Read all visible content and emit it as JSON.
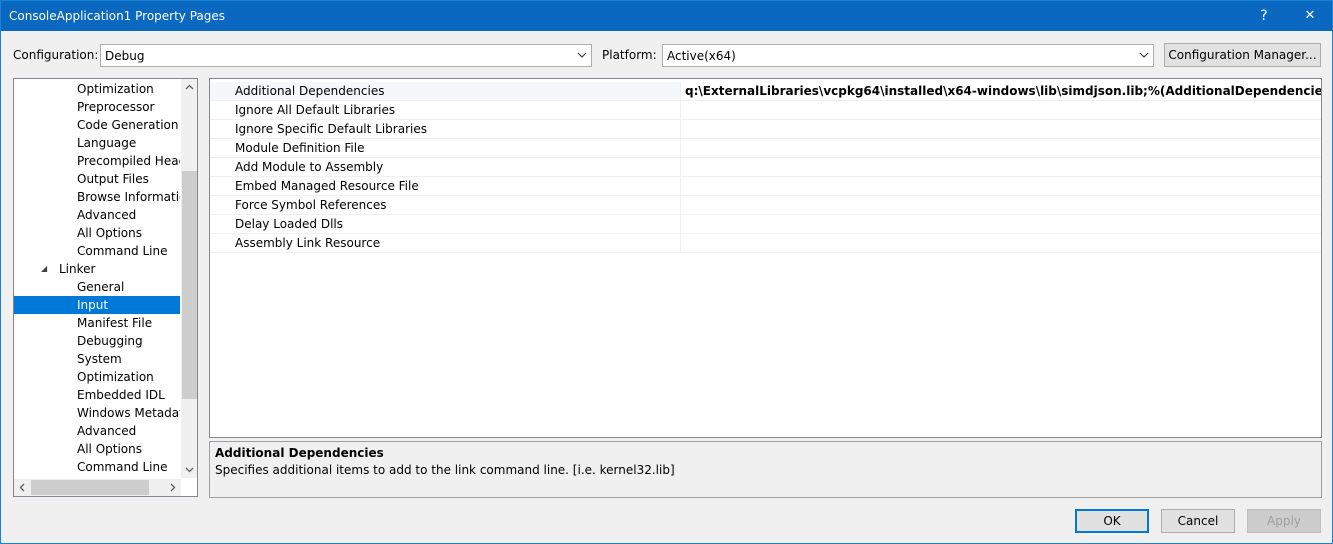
{
  "window": {
    "title": "ConsoleApplication1 Property Pages",
    "help_glyph": "?",
    "close_glyph": "✕"
  },
  "config_bar": {
    "configuration_label": "Configuration:",
    "configuration_value": "Debug",
    "platform_label": "Platform:",
    "platform_value": "Active(x64)",
    "config_manager_button": "Configuration Manager..."
  },
  "tree": {
    "items": [
      {
        "label": "Optimization"
      },
      {
        "label": "Preprocessor"
      },
      {
        "label": "Code Generation"
      },
      {
        "label": "Language"
      },
      {
        "label": "Precompiled Headers"
      },
      {
        "label": "Output Files"
      },
      {
        "label": "Browse Information"
      },
      {
        "label": "Advanced"
      },
      {
        "label": "All Options"
      },
      {
        "label": "Command Line"
      },
      {
        "label": "Linker"
      },
      {
        "label": "General"
      },
      {
        "label": "Input"
      },
      {
        "label": "Manifest File"
      },
      {
        "label": "Debugging"
      },
      {
        "label": "System"
      },
      {
        "label": "Optimization"
      },
      {
        "label": "Embedded IDL"
      },
      {
        "label": "Windows Metadata"
      },
      {
        "label": "Advanced"
      },
      {
        "label": "All Options"
      },
      {
        "label": "Command Line"
      }
    ],
    "expander_glyph": "◢"
  },
  "grid": {
    "rows": [
      {
        "name": "Additional Dependencies",
        "value": "q:\\ExternalLibraries\\vcpkg64\\installed\\x64-windows\\lib\\simdjson.lib;%(AdditionalDependencies)"
      },
      {
        "name": "Ignore All Default Libraries",
        "value": ""
      },
      {
        "name": "Ignore Specific Default Libraries",
        "value": ""
      },
      {
        "name": "Module Definition File",
        "value": ""
      },
      {
        "name": "Add Module to Assembly",
        "value": ""
      },
      {
        "name": "Embed Managed Resource File",
        "value": ""
      },
      {
        "name": "Force Symbol References",
        "value": ""
      },
      {
        "name": "Delay Loaded Dlls",
        "value": ""
      },
      {
        "name": "Assembly Link Resource",
        "value": ""
      }
    ]
  },
  "description": {
    "title": "Additional Dependencies",
    "text": "Specifies additional items to add to the link command line. [i.e. kernel32.lib]"
  },
  "buttons": {
    "ok": "OK",
    "cancel": "Cancel",
    "apply": "Apply"
  },
  "colors": {
    "titlebar": "#0b68c1",
    "selection": "#0078d7"
  }
}
